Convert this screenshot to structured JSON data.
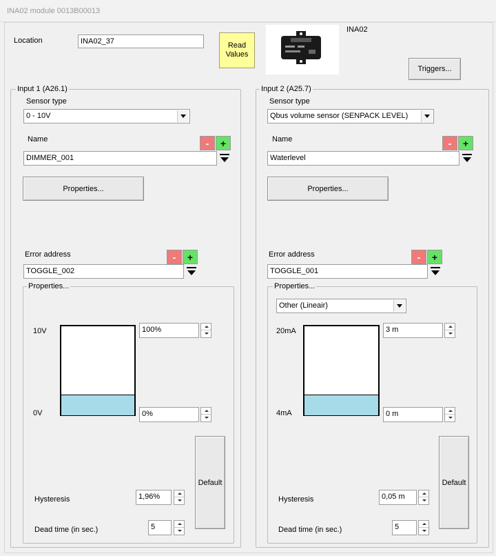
{
  "window": {
    "title": "INA02 module 0013B00013"
  },
  "header": {
    "location_label": "Location",
    "location_value": "INA02_37",
    "read_values_line1": "Read",
    "read_values_line2": "Values",
    "module_name": "INA02",
    "device_icon": "device-module-icon",
    "triggers_label": "Triggers..."
  },
  "inputs": [
    {
      "title": "Input 1 (A26.1)",
      "sensor_type_label": "Sensor type",
      "sensor_type_value": "0 - 10V",
      "name_label": "Name",
      "name_value": "DIMMER_001",
      "properties_button": "Properties...",
      "error_address_label": "Error address",
      "error_address_value": "TOGGLE_002",
      "properties_group_title": "Properties...",
      "scale_top_label": "10V",
      "scale_bottom_label": "0V",
      "top_value": "100%",
      "bottom_value": "0%",
      "fill_level": 0.23,
      "default_button": "Default",
      "hysteresis_label": "Hysteresis",
      "hysteresis_value": "1,96%",
      "dead_time_label": "Dead time (in sec.)",
      "dead_time_value": "5"
    },
    {
      "title": "Input 2 (A25.7)",
      "sensor_type_label": "Sensor type",
      "sensor_type_value": "Qbus volume sensor (SENPACK LEVEL)",
      "name_label": "Name",
      "name_value": "Waterlevel",
      "properties_button": "Properties...",
      "error_address_label": "Error address",
      "error_address_value": "TOGGLE_001",
      "properties_group_title": "Properties...",
      "mode_value": "Other (Lineair)",
      "scale_top_label": "20mA",
      "scale_bottom_label": "4mA",
      "top_value": "3 m",
      "bottom_value": "0 m",
      "fill_level": 0.23,
      "default_button": "Default",
      "hysteresis_label": "Hysteresis",
      "hysteresis_value": "0,05 m",
      "dead_time_label": "Dead time (in sec.)",
      "dead_time_value": "5"
    }
  ],
  "buttons": {
    "minus": "-",
    "plus": "+"
  },
  "colors": {
    "read_values_bg": "#ffff99",
    "minus_bg": "#f07a7a",
    "plus_bg": "#66e266",
    "gauge_fill": "#a7dbe9"
  }
}
